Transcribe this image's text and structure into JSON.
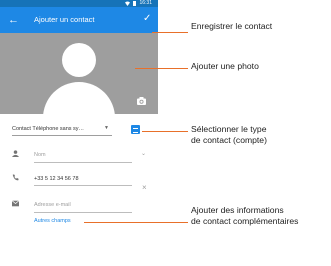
{
  "status_bar": {
    "time": "16:31"
  },
  "app_bar": {
    "back_icon": "arrow-left-icon",
    "title": "Ajouter un contact",
    "save_icon": "check-icon"
  },
  "photo": {
    "camera_icon": "camera-icon"
  },
  "form": {
    "account_select": "Contact Téléphone sans sy…",
    "name_placeholder": "Nom",
    "phone_value": "+33 5 12 34 56 78",
    "email_placeholder": "Adresse e-mail",
    "more_fields": "Autres champs"
  },
  "callouts": {
    "save": "Enregistrer le contact",
    "photo": "Ajouter une photo",
    "account_line1": "Sélectionner le type",
    "account_line2": "de contact (compte)",
    "more_line1": "Ajouter des informations",
    "more_line2": "de contact complémentaires"
  },
  "colors": {
    "accent": "#1e88e5",
    "callout_line": "#e8702a",
    "photo_bg": "#9e9e9e"
  }
}
